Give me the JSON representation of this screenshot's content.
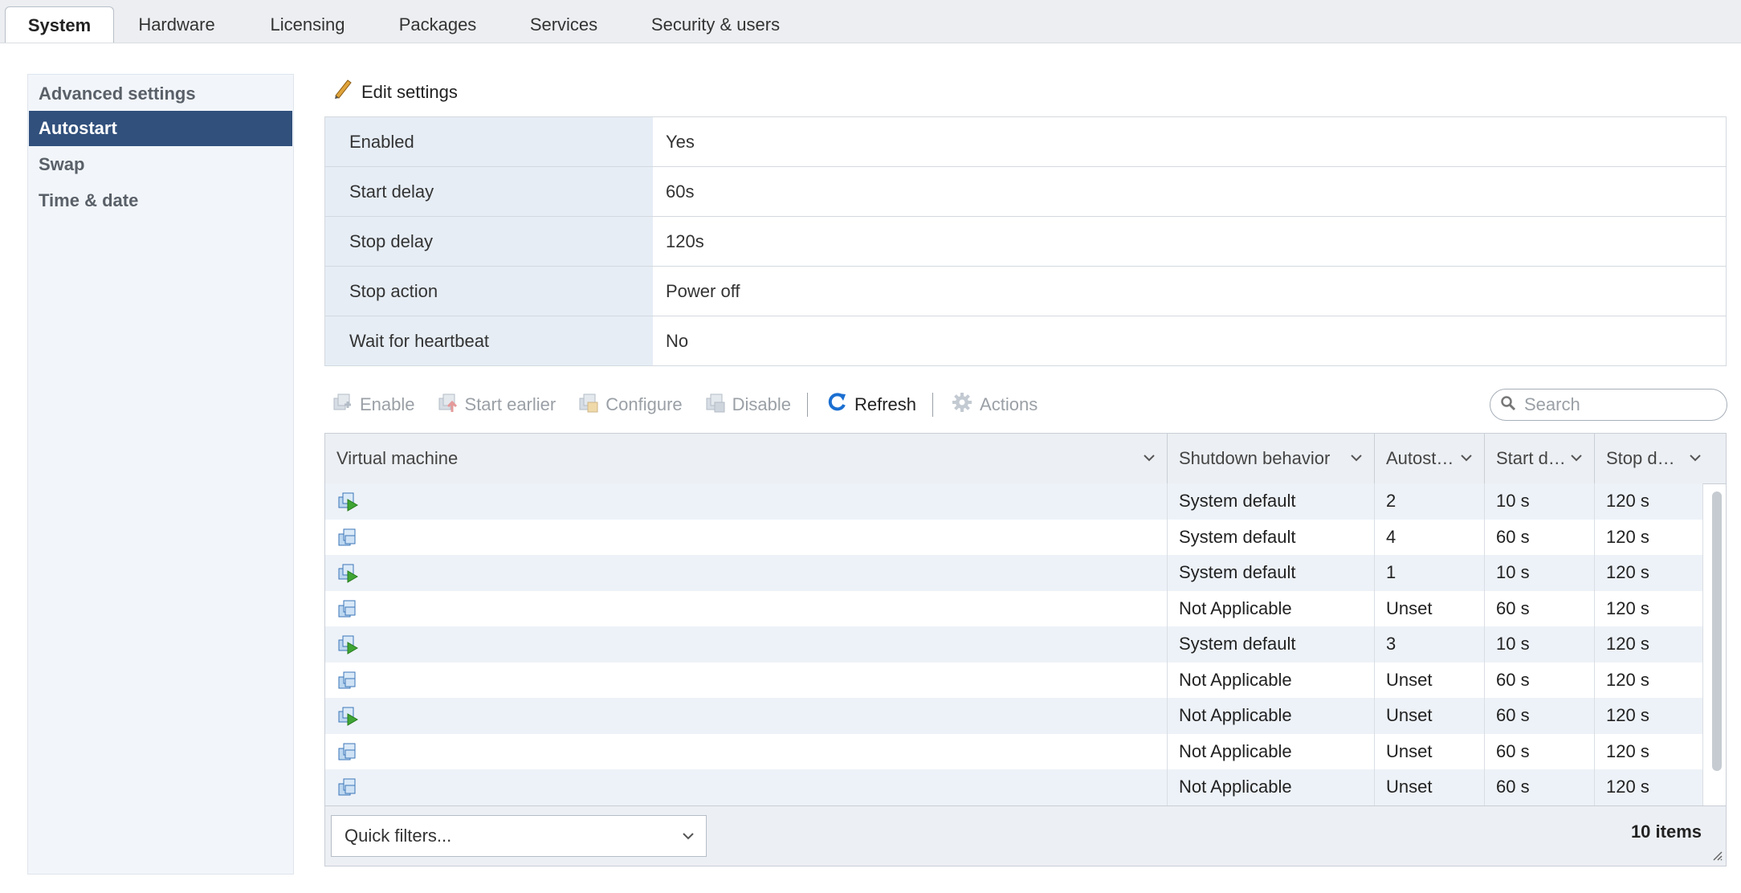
{
  "tabs": [
    "System",
    "Hardware",
    "Licensing",
    "Packages",
    "Services",
    "Security & users"
  ],
  "nav": [
    "Advanced settings",
    "Autostart",
    "Swap",
    "Time & date"
  ],
  "edit_label": "Edit settings",
  "settings": [
    {
      "key": "Enabled",
      "value": "Yes"
    },
    {
      "key": "Start delay",
      "value": "60s"
    },
    {
      "key": "Stop delay",
      "value": "120s"
    },
    {
      "key": "Stop action",
      "value": "Power off"
    },
    {
      "key": "Wait for heartbeat",
      "value": "No"
    }
  ],
  "toolbar": {
    "enable": "Enable",
    "start_earlier": "Start earlier",
    "configure": "Configure",
    "disable": "Disable",
    "refresh": "Refresh",
    "actions": "Actions"
  },
  "search": {
    "placeholder": "Search"
  },
  "columns": [
    "Virtual machine",
    "Shutdown behavior",
    "Autost…",
    "Start d…",
    "Stop d…"
  ],
  "rows": [
    {
      "icon": "vm-powered-on-icon",
      "shutdown": "System default",
      "autostart": "2",
      "start": "10 s",
      "stop": "120 s"
    },
    {
      "icon": "vm-icon",
      "shutdown": "System default",
      "autostart": "4",
      "start": "60 s",
      "stop": "120 s"
    },
    {
      "icon": "vm-powered-on-icon",
      "shutdown": "System default",
      "autostart": "1",
      "start": "10 s",
      "stop": "120 s"
    },
    {
      "icon": "vm-icon",
      "shutdown": "Not Applicable",
      "autostart": "Unset",
      "start": "60 s",
      "stop": "120 s"
    },
    {
      "icon": "vm-powered-on-icon",
      "shutdown": "System default",
      "autostart": "3",
      "start": "10 s",
      "stop": "120 s"
    },
    {
      "icon": "vm-icon",
      "shutdown": "Not Applicable",
      "autostart": "Unset",
      "start": "60 s",
      "stop": "120 s"
    },
    {
      "icon": "vm-powered-on-icon",
      "shutdown": "Not Applicable",
      "autostart": "Unset",
      "start": "60 s",
      "stop": "120 s"
    },
    {
      "icon": "vm-icon",
      "shutdown": "Not Applicable",
      "autostart": "Unset",
      "start": "60 s",
      "stop": "120 s"
    },
    {
      "icon": "vm-icon",
      "shutdown": "Not Applicable",
      "autostart": "Unset",
      "start": "60 s",
      "stop": "120 s"
    }
  ],
  "footer": {
    "quick_filters": "Quick filters...",
    "count": "10 items"
  },
  "colors": {
    "accent": "#31507c",
    "refresh": "#1b6fd1",
    "powered_on": "#3fa534"
  }
}
